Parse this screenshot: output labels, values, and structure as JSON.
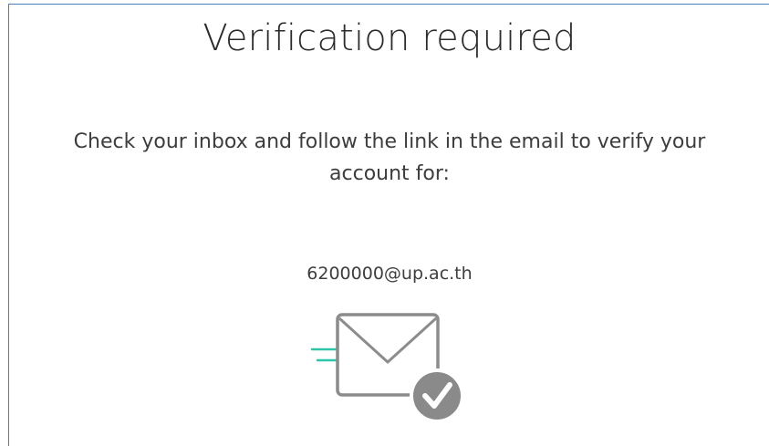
{
  "page": {
    "title": "Verification required",
    "message": "Check your inbox and follow the link in the email to verify your account for:",
    "email": "6200000@up.ac.th",
    "illustration": "envelope-with-checkmark-icon"
  },
  "colors": {
    "panel_border": "#4a7fc1",
    "envelope_stroke": "#8c8c8c",
    "check_badge": "#8a8a8a",
    "motion_lines": "#2ec4a8"
  }
}
